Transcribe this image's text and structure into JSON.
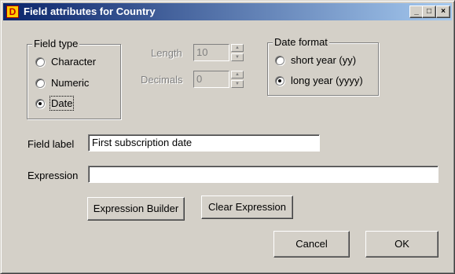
{
  "window": {
    "title": "Field attributes for Country",
    "minimize_glyph": "_",
    "maximize_glyph": "□",
    "close_glyph": "×",
    "app_icon_glyph": "D"
  },
  "field_type": {
    "legend": "Field type",
    "options": [
      "Character",
      "Numeric",
      "Date"
    ],
    "selected": "Date"
  },
  "length": {
    "label": "Length",
    "value": "10"
  },
  "decimals": {
    "label": "Decimals",
    "value": "0"
  },
  "date_format": {
    "legend": "Date format",
    "options": [
      "short year (yy)",
      "long year (yyyy)"
    ],
    "selected": "long year (yyyy)"
  },
  "field_label": {
    "label": "Field label",
    "value": "First subscription date"
  },
  "expression": {
    "label": "Expression",
    "value": ""
  },
  "buttons": {
    "expression_builder": "Expression Builder",
    "clear_expression": "Clear Expression",
    "cancel": "Cancel",
    "ok": "OK"
  }
}
